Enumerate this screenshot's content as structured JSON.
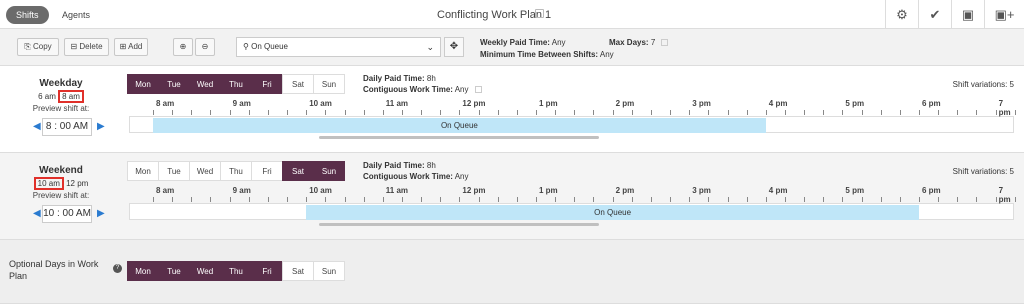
{
  "header": {
    "tabs": [
      {
        "label": "Shifts",
        "active": true
      },
      {
        "label": "Agents",
        "active": false
      }
    ],
    "title": "Conflicting Work Plan 1",
    "actions": [
      "gear-icon",
      "check-icon",
      "save-icon",
      "save-plus-icon"
    ]
  },
  "toolbar": {
    "copy_label": "Copy",
    "delete_label": "Delete",
    "add_label": "Add",
    "activity_value": "On Queue",
    "weekly_paid_label": "Weekly Paid Time:",
    "weekly_paid_value": "Any",
    "min_time_label": "Minimum Time Between Shifts:",
    "min_time_value": "Any",
    "max_days_label": "Max Days:",
    "max_days_value": "7"
  },
  "hours": [
    "8 am",
    "9 am",
    "10 am",
    "11 am",
    "12 pm",
    "1 pm",
    "2 pm",
    "3 pm",
    "4 pm",
    "5 pm",
    "6 pm",
    "7 pm"
  ],
  "days": [
    "Mon",
    "Tue",
    "Wed",
    "Thu",
    "Fri",
    "Sat",
    "Sun"
  ],
  "weekday": {
    "name": "Weekday",
    "start": "6 am",
    "end": "8 am",
    "preview_label": "Preview shift at:",
    "preview_time": "8 : 00  AM",
    "selected_days": [
      true,
      true,
      true,
      true,
      true,
      false,
      false
    ],
    "daily_paid_label": "Daily Paid Time:",
    "daily_paid_value": "8h",
    "contig_label": "Contiguous Work Time:",
    "contig_value": "Any",
    "variations": "Shift variations: 5",
    "bar_label": "On Queue",
    "bar_start_hour": 8,
    "bar_end_hour": 16
  },
  "weekend": {
    "name": "Weekend",
    "start": "10 am",
    "end": "12 pm",
    "preview_label": "Preview shift at:",
    "preview_time": "10 : 00  AM",
    "selected_days": [
      false,
      false,
      false,
      false,
      false,
      true,
      true
    ],
    "daily_paid_label": "Daily Paid Time:",
    "daily_paid_value": "8h",
    "contig_label": "Contiguous Work Time:",
    "contig_value": "Any",
    "variations": "Shift variations: 5",
    "bar_label": "On Queue",
    "bar_start_hour": 10,
    "bar_end_hour": 18
  },
  "optional": {
    "label": "Optional Days in Work Plan",
    "selected_days": [
      true,
      true,
      true,
      true,
      true,
      false,
      false
    ]
  }
}
